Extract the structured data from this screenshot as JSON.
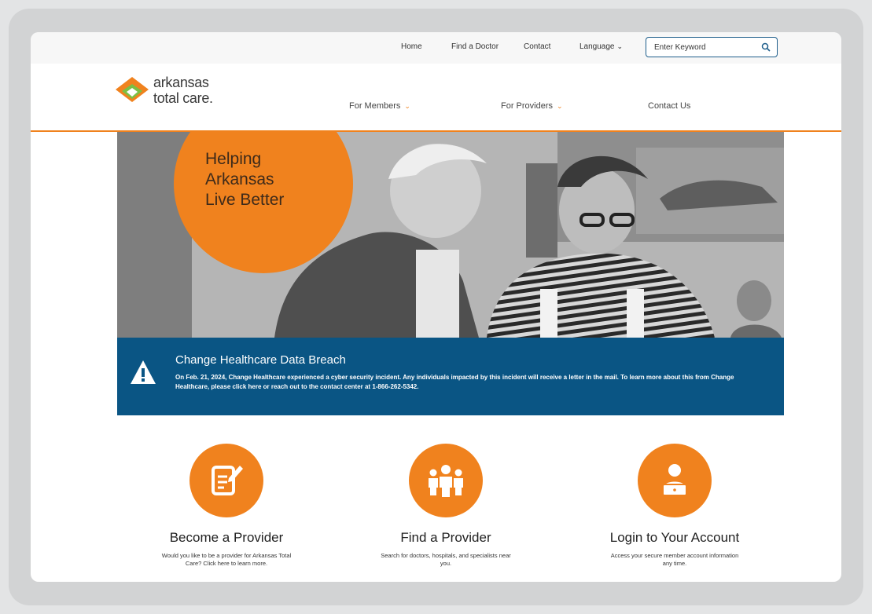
{
  "utility_nav": {
    "home": "Home",
    "find_a_doctor": "Find a Doctor",
    "contact": "Contact",
    "language": "Language",
    "search_placeholder": "Enter Keyword"
  },
  "logo": {
    "line1": "arkansas",
    "line2": "total care."
  },
  "main_nav": {
    "members": "For Members",
    "providers": "For Providers",
    "contact_us": "Contact Us"
  },
  "hero": {
    "headline": "Helping\nArkansas\nLive Better"
  },
  "alert": {
    "title": "Change Healthcare Data Breach",
    "body": "On Feb. 21, 2024, Change Healthcare experienced a cyber security incident. Any individuals impacted by this incident will receive a letter in the mail. To learn more about this from Change Healthcare, please click here or reach out to the contact center at 1-866-262-5342."
  },
  "cards": [
    {
      "title": "Become a Provider",
      "desc": "Would you like to be a provider for Arkansas Total Care? Click here to learn more."
    },
    {
      "title": "Find a Provider",
      "desc": "Search for doctors, hospitals, and specialists near you."
    },
    {
      "title": "Login to Your Account",
      "desc": "Access your secure member account information any time."
    }
  ],
  "colors": {
    "brand_orange": "#f0821e",
    "alert_blue": "#0a5584"
  }
}
